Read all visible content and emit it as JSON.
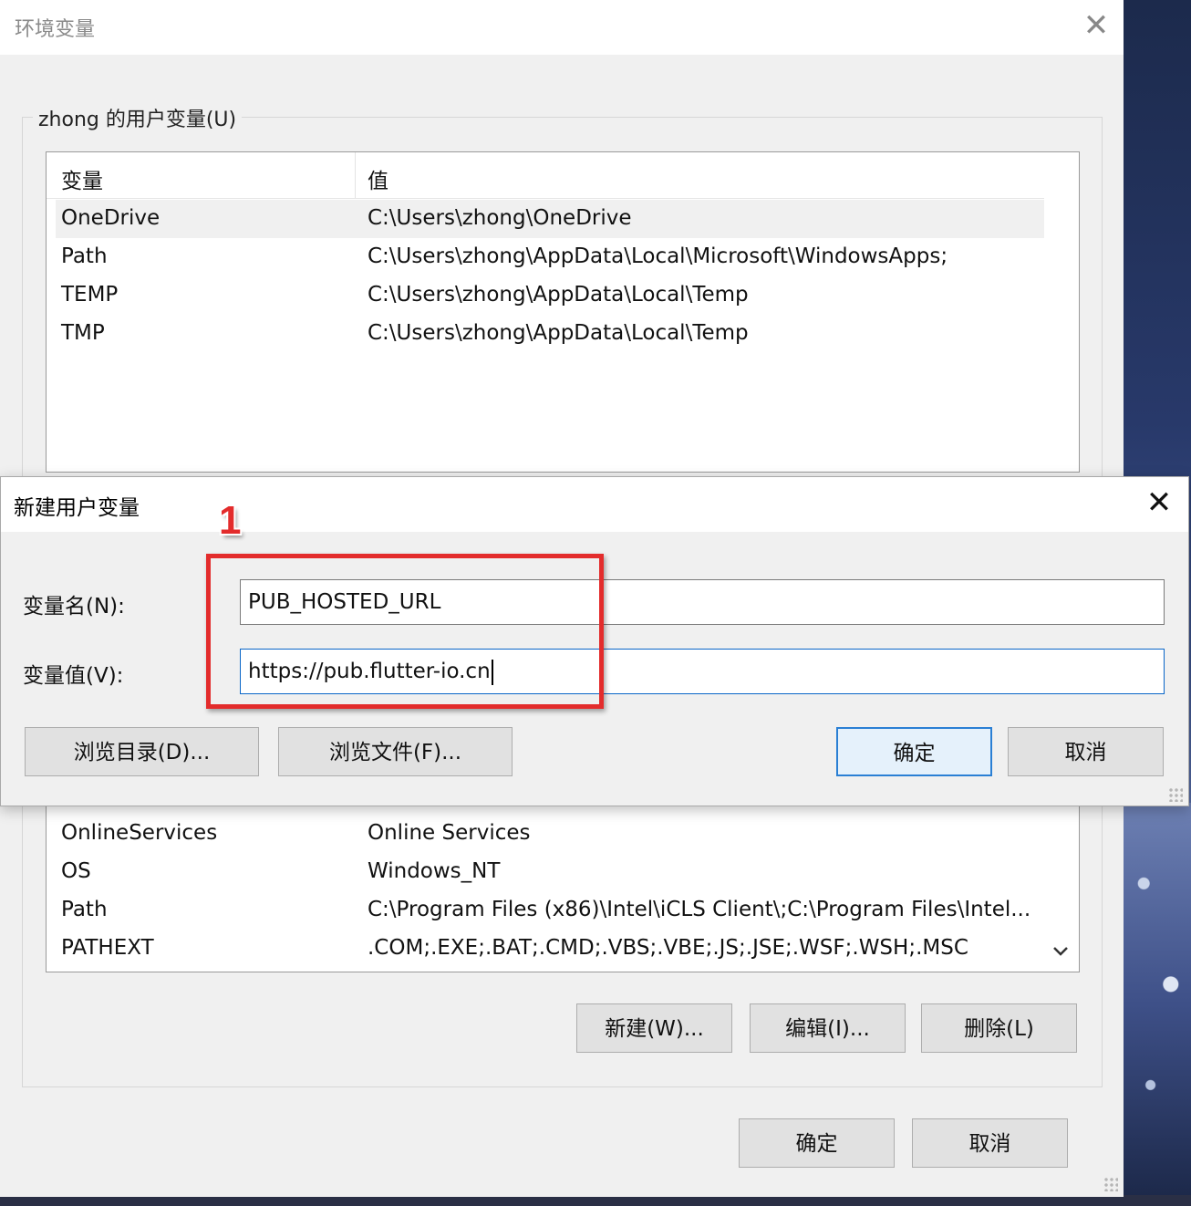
{
  "main_window": {
    "title": "环境变量",
    "close_glyph": "✕",
    "user_group_label": "zhong 的用户变量(U)",
    "user_vars": {
      "header_name": "变量",
      "header_value": "值",
      "rows": [
        {
          "name": "OneDrive",
          "value": "C:\\Users\\zhong\\OneDrive"
        },
        {
          "name": "Path",
          "value": "C:\\Users\\zhong\\AppData\\Local\\Microsoft\\WindowsApps;"
        },
        {
          "name": "TEMP",
          "value": "C:\\Users\\zhong\\AppData\\Local\\Temp"
        },
        {
          "name": "TMP",
          "value": "C:\\Users\\zhong\\AppData\\Local\\Temp"
        }
      ]
    },
    "system_vars": {
      "rows": [
        {
          "name": "OnlineServices",
          "value": "Online Services"
        },
        {
          "name": "OS",
          "value": "Windows_NT"
        },
        {
          "name": "Path",
          "value": "C:\\Program Files (x86)\\Intel\\iCLS Client\\;C:\\Program Files\\Intel..."
        },
        {
          "name": "PATHEXT",
          "value": ".COM;.EXE;.BAT;.CMD;.VBS;.VBE;.JS;.JSE;.WSF;.WSH;.MSC"
        }
      ],
      "new_button": "新建(W)...",
      "edit_button": "编辑(I)...",
      "delete_button": "删除(L)"
    },
    "ok_button": "确定",
    "cancel_button": "取消"
  },
  "dialog": {
    "title": "新建用户变量",
    "close_glyph": "✕",
    "name_label": "变量名(N):",
    "name_value": "PUB_HOSTED_URL",
    "value_label": "变量值(V):",
    "value_value": "https://pub.flutter-io.cn",
    "browse_dir_button": "浏览目录(D)...",
    "browse_file_button": "浏览文件(F)...",
    "ok_button": "确定",
    "cancel_button": "取消"
  },
  "annotation": {
    "number": "1",
    "color": "#e32c2c"
  },
  "colors": {
    "focus_accent": "#2a7fd4"
  }
}
